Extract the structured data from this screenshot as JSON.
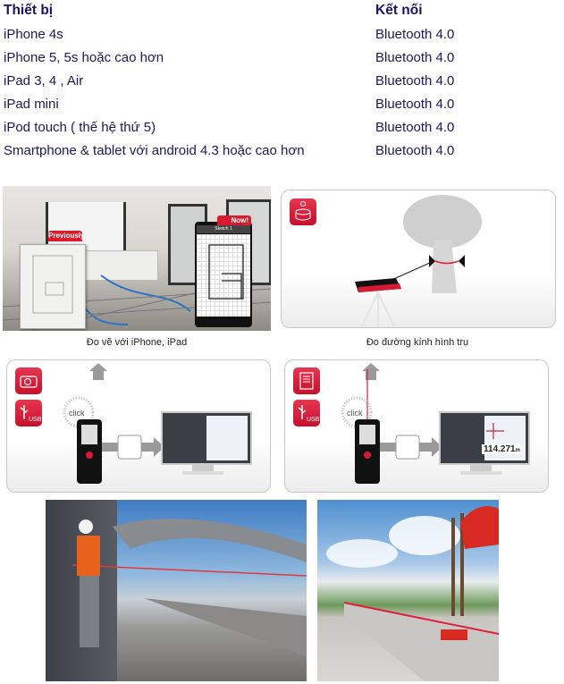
{
  "table": {
    "headers": {
      "device": "Thiết bị",
      "connection": "Kết nối"
    },
    "rows": [
      {
        "device": "iPhone 4s",
        "connection": "Bluetooth 4.0"
      },
      {
        "device": "iPhone 5, 5s hoặc cao hơn",
        "connection": "Bluetooth 4.0"
      },
      {
        "device": "iPad 3, 4 , Air",
        "connection": "Bluetooth 4.0"
      },
      {
        "device": "iPad mini",
        "connection": "Bluetooth 4.0"
      },
      {
        "device": "iPod touch ( thế hệ thứ 5)",
        "connection": "Bluetooth 4.0"
      },
      {
        "device": "Smartphone & tablet với android 4.3 hoặc cao hơn",
        "connection": "Bluetooth 4.0"
      }
    ]
  },
  "figures": {
    "sketch": {
      "caption": "Đo vẽ với iPhone, iPad",
      "label_previously": "Previously",
      "label_now": "Now!",
      "app_title": "Sketch 1"
    },
    "diameter": {
      "caption": "Đo đường kính hình trụ",
      "icon": "cylinder-diameter-icon"
    },
    "usb_photo": {
      "click_label": "click",
      "usb_label": "USB",
      "icons": [
        "camera-icon",
        "usb-icon"
      ]
    },
    "usb_measure": {
      "click_label": "click",
      "usb_label": "USB",
      "readout": "114.271",
      "unit": "m",
      "icons": [
        "document-icon",
        "usb-icon"
      ]
    }
  },
  "photos": [
    {
      "alt": "Worker measuring at railway bridge"
    },
    {
      "alt": "Worker measuring concrete beam"
    }
  ],
  "colors": {
    "accent": "#c6102c",
    "header_text": "#1c1266",
    "body_text": "#1a1a5a"
  }
}
